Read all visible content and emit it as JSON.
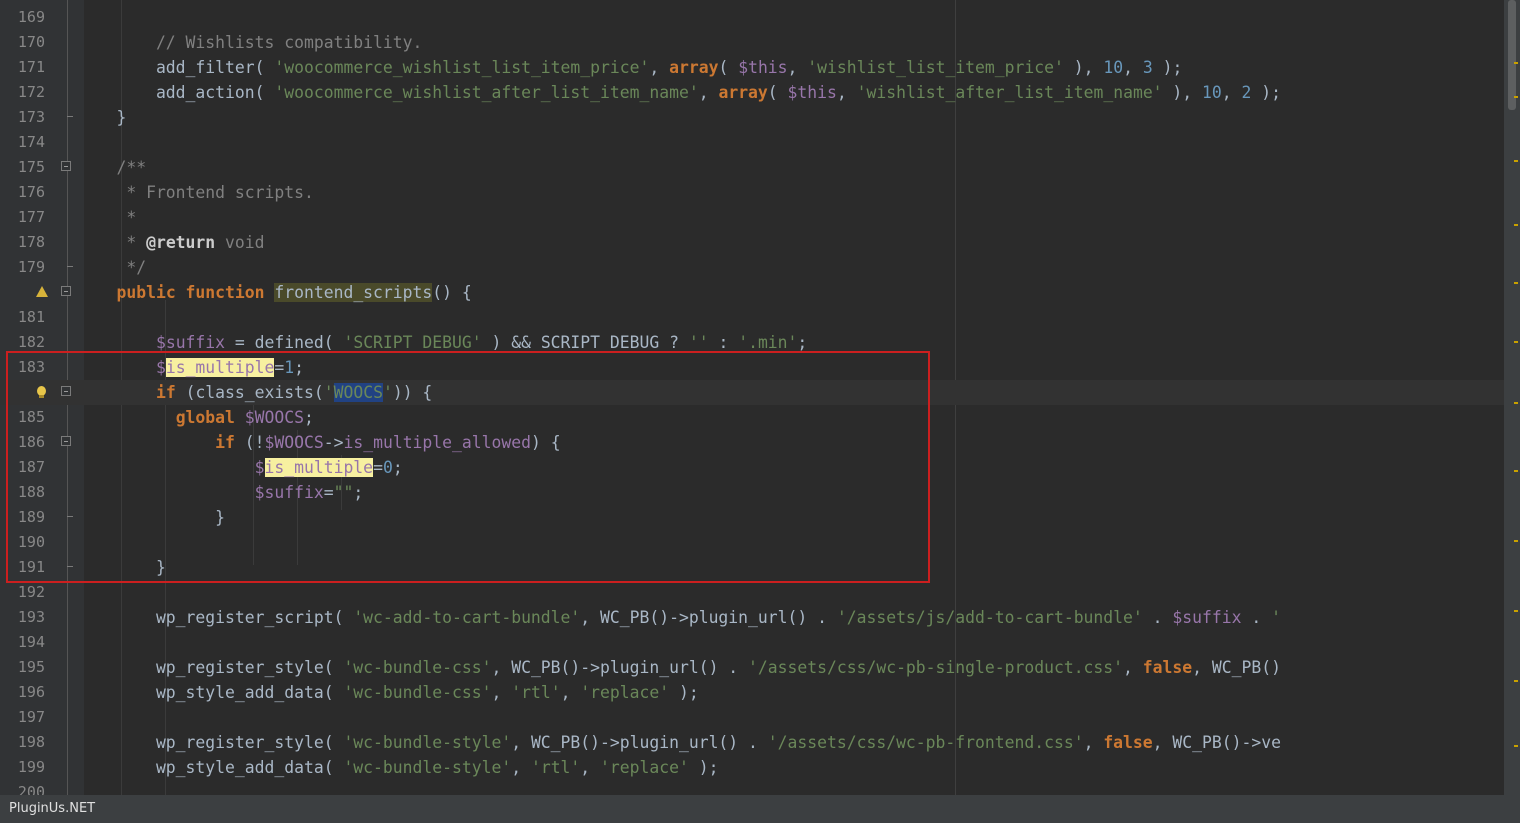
{
  "editor": {
    "lines": [
      {
        "num": "169",
        "code": ""
      },
      {
        "num": "170",
        "code": "// Wishlists compatibility."
      },
      {
        "num": "171",
        "code": "add_filter( 'woocommerce_wishlist_list_item_price', array( $this, 'wishlist_list_item_price' ), 10, 3 );"
      },
      {
        "num": "172",
        "code": "add_action( 'woocommerce_wishlist_after_list_item_name', array( $this, 'wishlist_after_list_item_name' ), 10, 2 );"
      },
      {
        "num": "173",
        "code": "}"
      },
      {
        "num": "174",
        "code": ""
      },
      {
        "num": "175",
        "code": "/**"
      },
      {
        "num": "176",
        "code": " * Frontend scripts."
      },
      {
        "num": "177",
        "code": " *"
      },
      {
        "num": "178",
        "code": " * @return void"
      },
      {
        "num": "179",
        "code": " */"
      },
      {
        "num": "",
        "code": "public function frontend_scripts() {"
      },
      {
        "num": "181",
        "code": ""
      },
      {
        "num": "182",
        "code": "$suffix = defined( 'SCRIPT_DEBUG' ) && SCRIPT_DEBUG ? '' : '.min';"
      },
      {
        "num": "183",
        "code": "$is_multiple=1;"
      },
      {
        "num": "",
        "code": "if (class_exists('WOOCS')) {"
      },
      {
        "num": "185",
        "code": "global $WOOCS;"
      },
      {
        "num": "186",
        "code": "if (!$WOOCS->is_multiple_allowed) {"
      },
      {
        "num": "187",
        "code": "$is_multiple=0;"
      },
      {
        "num": "188",
        "code": "$suffix=\"\";"
      },
      {
        "num": "189",
        "code": "}"
      },
      {
        "num": "190",
        "code": ""
      },
      {
        "num": "191",
        "code": "}"
      },
      {
        "num": "192",
        "code": ""
      },
      {
        "num": "193",
        "code": "wp_register_script( 'wc-add-to-cart-bundle', WC_PB()->plugin_url() . '/assets/js/add-to-cart-bundle' . $suffix . '"
      },
      {
        "num": "194",
        "code": ""
      },
      {
        "num": "195",
        "code": "wp_register_style( 'wc-bundle-css', WC_PB()->plugin_url() . '/assets/css/wc-pb-single-product.css', false, WC_PB()"
      },
      {
        "num": "196",
        "code": "wp_style_add_data( 'wc-bundle-css', 'rtl', 'replace' );"
      },
      {
        "num": "197",
        "code": ""
      },
      {
        "num": "198",
        "code": "wp_register_style( 'wc-bundle-style', WC_PB()->plugin_url() . '/assets/css/wc-pb-frontend.css', false, WC_PB()->ve"
      },
      {
        "num": "199",
        "code": "wp_style_add_data( 'wc-bundle-style', 'rtl', 'replace' );"
      },
      {
        "num": "200",
        "code": ""
      }
    ]
  },
  "gutter_icons": {
    "line_180": "warning-icon",
    "line_184": "intention-bulb-icon"
  },
  "colors": {
    "background": "#2b2b2b",
    "keyword": "#cc7832",
    "string": "#6a8759",
    "number": "#6897bb",
    "variable": "#9876aa",
    "comment": "#808080",
    "highlight_box": "#cc1f1f",
    "identifier_highlight": "#f7f0a0"
  },
  "status": {
    "watermark": "PluginUs.NET"
  }
}
